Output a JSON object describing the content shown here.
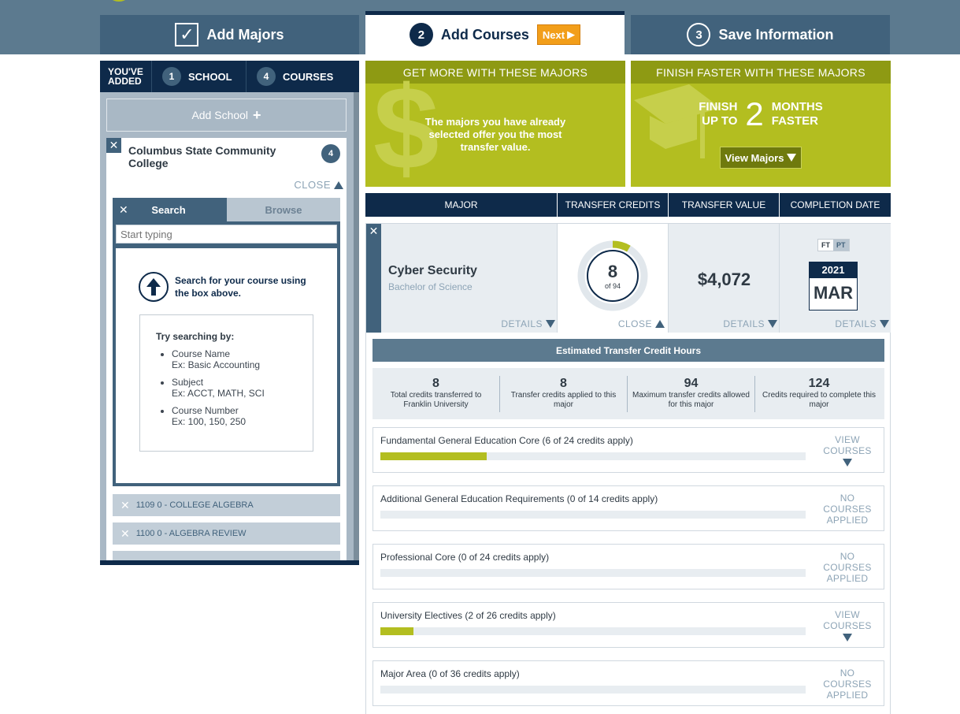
{
  "steps": {
    "step1_label": "Add Majors",
    "step2_number": "2",
    "step2_label": "Add Courses",
    "next_label": "Next",
    "step3_number": "3",
    "step3_label": "Save Information"
  },
  "added": {
    "title_line1": "YOU'VE",
    "title_line2": "ADDED",
    "school_count": "1",
    "school_label": "SCHOOL",
    "courses_count": "4",
    "courses_label": "COURSES"
  },
  "left": {
    "add_school_label": "Add School",
    "school_name": "Columbus State Community College",
    "school_course_count": "4",
    "close_label": "CLOSE",
    "tab_search": "Search",
    "tab_browse": "Browse",
    "search_placeholder": "Start typing",
    "hint": "Search for your course using the box above.",
    "try_title": "Try searching by:",
    "try_items": [
      {
        "name": "Course Name",
        "ex": "Ex: Basic Accounting"
      },
      {
        "name": "Subject",
        "ex": "Ex: ACCT, MATH, SCI"
      },
      {
        "name": "Course Number",
        "ex": "Ex: 100, 150, 250"
      }
    ],
    "courses": [
      "1109 0 - COLLEGE ALGEBRA",
      "1100 0 - ALGEBRA REVIEW"
    ]
  },
  "promo1": {
    "heading": "GET MORE WITH THESE MAJORS",
    "text": "The majors you have already selected offer you the most transfer value."
  },
  "promo2": {
    "heading": "FINISH FASTER WITH THESE MAJORS",
    "finish_line1": "FINISH",
    "finish_line2": "UP TO",
    "number": "2",
    "months_line1": "MONTHS",
    "months_line2": "FASTER",
    "button": "View Majors"
  },
  "table": {
    "headers": [
      "MAJOR",
      "TRANSFER CREDITS",
      "TRANSFER VALUE",
      "COMPLETION DATE"
    ],
    "major_name": "Cyber Security",
    "major_degree": "Bachelor of Science",
    "details_label": "DETAILS",
    "close_label": "CLOSE",
    "credits": "8",
    "credits_of": "of 94",
    "credits_fraction": 0.085,
    "transfer_value": "$4,072",
    "ft_label": "FT",
    "pt_label": "PT",
    "completion_year": "2021",
    "completion_month": "MAR"
  },
  "estimate": {
    "heading": "Estimated Transfer Credit Hours",
    "stats": [
      {
        "num": "8",
        "label": "Total credits transferred to Franklin University"
      },
      {
        "num": "8",
        "label": "Transfer credits applied to this major"
      },
      {
        "num": "94",
        "label": "Maximum transfer credits allowed for this major"
      },
      {
        "num": "124",
        "label": "Credits required to complete this major"
      }
    ]
  },
  "requirements": [
    {
      "title": "Fundamental General Education Core (6 of 24 credits apply)",
      "fraction": 0.25,
      "action": "VIEW COURSES",
      "expandable": true
    },
    {
      "title": "Additional General Education Requirements (0 of 14 credits apply)",
      "fraction": 0,
      "action": "NO COURSES APPLIED",
      "expandable": false
    },
    {
      "title": "Professional Core (0 of 24 credits apply)",
      "fraction": 0,
      "action": "NO COURSES APPLIED",
      "expandable": false
    },
    {
      "title": "University Electives (2 of 26 credits apply)",
      "fraction": 0.077,
      "action": "VIEW COURSES",
      "expandable": true
    },
    {
      "title": "Major Area (0 of 36 credits apply)",
      "fraction": 0,
      "action": "NO COURSES APPLIED",
      "expandable": false
    }
  ]
}
